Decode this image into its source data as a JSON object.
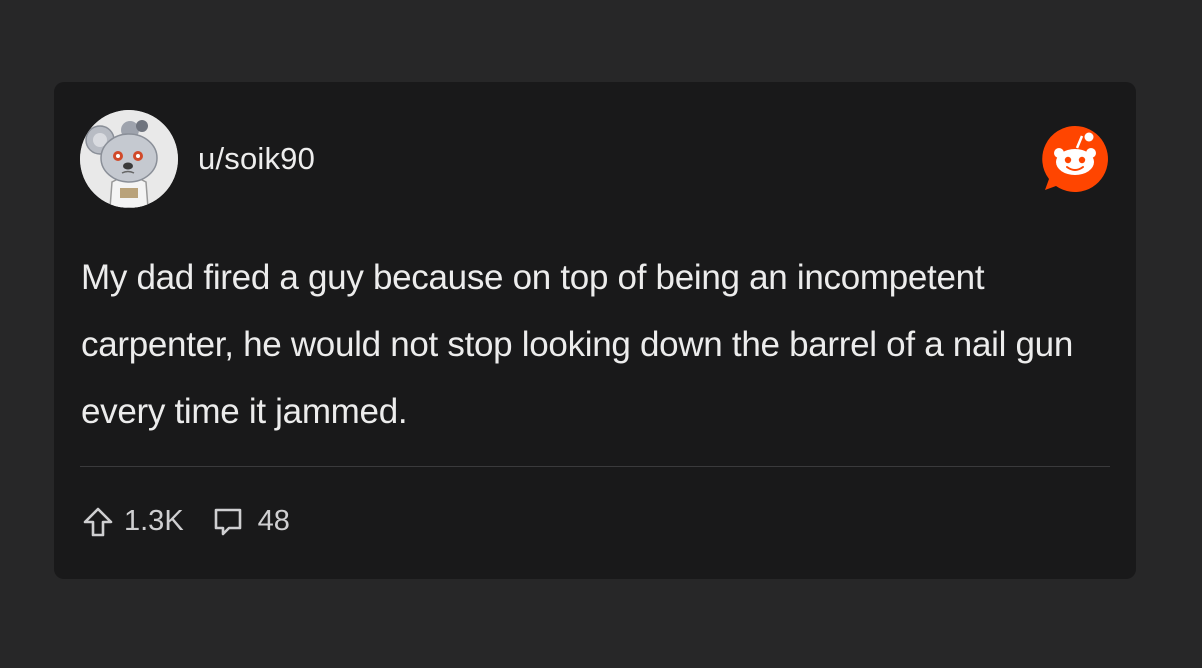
{
  "post": {
    "username": "u/soik90",
    "avatar_icon": "snoo-koala-avatar-icon",
    "logo_icon": "reddit-logo-icon",
    "body": "My dad fired a guy because on top of being an incompetent carpenter, he would not stop looking down the barrel of a nail gun every time it jammed.",
    "upvotes": "1.3K",
    "comments": "48",
    "upvote_icon": "upvote-arrow-icon",
    "comment_icon": "comment-bubble-icon"
  },
  "colors": {
    "page_background": "#272728",
    "card_background": "#19191a",
    "text": "#ececec",
    "reddit_orange": "#ff4500"
  }
}
